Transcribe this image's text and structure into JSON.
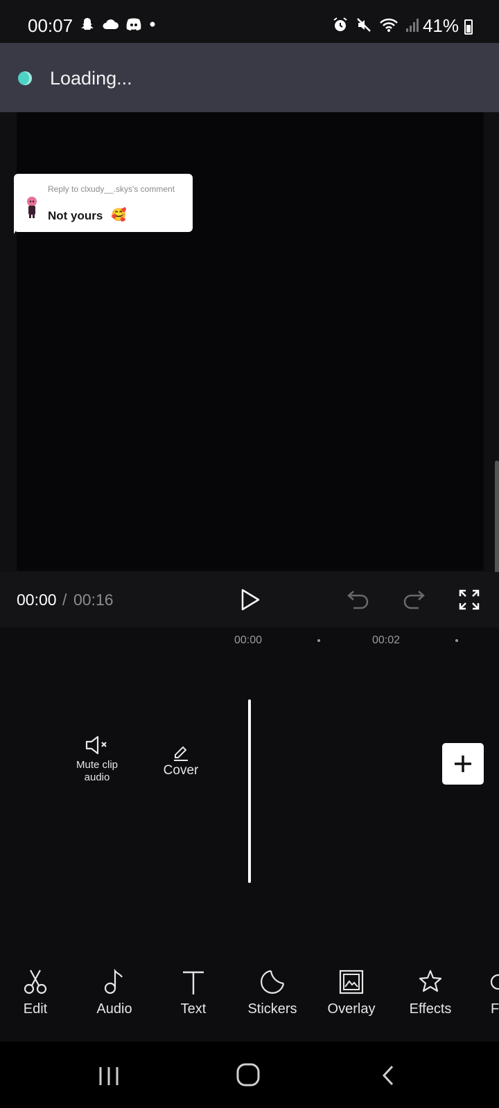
{
  "status_bar": {
    "time": "00:07",
    "battery_percent": "41%",
    "left_icons": [
      "snapchat-icon",
      "cloud-icon",
      "discord-icon",
      "dot-icon"
    ],
    "right_icons": [
      "alarm-icon",
      "mute-icon",
      "wifi-icon",
      "signal-icon",
      "battery-icon"
    ]
  },
  "loading": {
    "text": "Loading...",
    "accent": "#4fd1c5"
  },
  "preview": {
    "reply_label": "Reply to clxudy__.skys's comment",
    "reply_text": "Not yours",
    "reply_emoji": "🥰"
  },
  "playback": {
    "current_time": "00:00",
    "separator": "/",
    "total_time": "00:16"
  },
  "timeline": {
    "ticks": [
      "00:00",
      "00:02"
    ],
    "mute_label": "Mute clip audio",
    "cover_label": "Cover"
  },
  "toolbar": {
    "items": [
      {
        "label": "Edit",
        "icon": "scissors-icon"
      },
      {
        "label": "Audio",
        "icon": "music-note-icon"
      },
      {
        "label": "Text",
        "icon": "text-icon"
      },
      {
        "label": "Stickers",
        "icon": "sticker-icon"
      },
      {
        "label": "Overlay",
        "icon": "overlay-icon"
      },
      {
        "label": "Effects",
        "icon": "effects-star-icon"
      },
      {
        "label": "F",
        "icon": "filters-icon"
      }
    ]
  },
  "nav_bar": {
    "icons": [
      "recent-apps-icon",
      "home-icon",
      "back-icon"
    ]
  }
}
